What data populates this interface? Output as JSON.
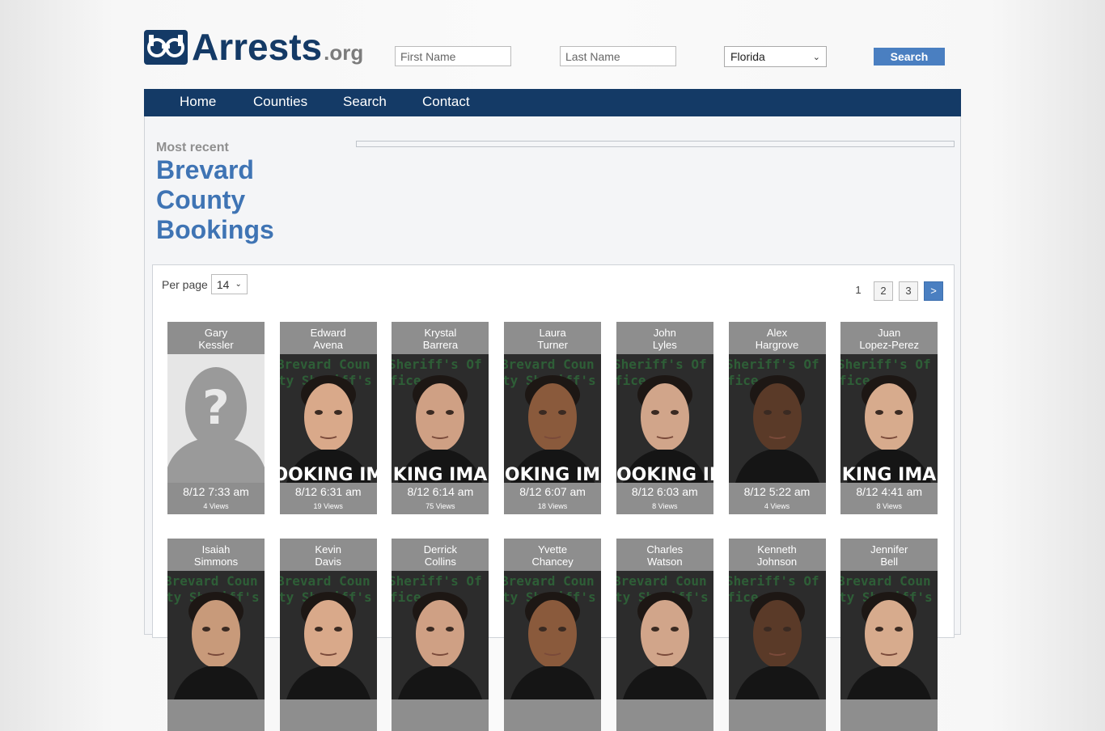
{
  "site": {
    "name": "Arrests",
    "tld": ".org"
  },
  "header": {
    "first_name_placeholder": "First Name",
    "last_name_placeholder": "Last Name",
    "state_selected": "Florida",
    "search_label": "Search"
  },
  "nav": {
    "items": [
      "Home",
      "Counties",
      "Search",
      "Contact"
    ]
  },
  "page": {
    "subheading": "Most recent",
    "title": "Brevard County Bookings"
  },
  "listing": {
    "per_page_label": "Per page",
    "per_page_value": "14",
    "pages": [
      "1",
      "2",
      "3"
    ],
    "next_label": ">",
    "cards": [
      {
        "first": "Gary",
        "last": "Kessler",
        "time": "8/12 7:33 am",
        "views": "4 Views",
        "photo": "placeholder-silhouette"
      },
      {
        "first": "Edward",
        "last": "Avena",
        "time": "8/12 6:31 am",
        "views": "19 Views",
        "photo": "mugshot",
        "overlay": "BOOKING IMA",
        "watermark": "Brevard County Sheriff's Office"
      },
      {
        "first": "Krystal",
        "last": "Barrera",
        "time": "8/12 6:14 am",
        "views": "75 Views",
        "photo": "mugshot",
        "overlay": "KING IMA",
        "watermark": "Sheriff's Office"
      },
      {
        "first": "Laura",
        "last": "Turner",
        "time": "8/12 6:07 am",
        "views": "18 Views",
        "photo": "mugshot",
        "overlay": "OKING IM",
        "watermark": "Brevard County Sheriff's Office"
      },
      {
        "first": "John",
        "last": "Lyles",
        "time": "8/12 6:03 am",
        "views": "8 Views",
        "photo": "mugshot",
        "overlay": "BOOKING IM",
        "watermark": "Sheriff's Office"
      },
      {
        "first": "Alex",
        "last": "Hargrove",
        "time": "8/12 5:22 am",
        "views": "4 Views",
        "photo": "mugshot",
        "overlay": "",
        "watermark": "Sheriff's Office"
      },
      {
        "first": "Juan",
        "last": "Lopez-Perez",
        "time": "8/12 4:41 am",
        "views": "8 Views",
        "photo": "mugshot",
        "overlay": "KING IMA",
        "watermark": "Sheriff's Office"
      },
      {
        "first": "Isaiah",
        "last": "Simmons",
        "photo": "mugshot",
        "watermark": "Brevard County Sheriff's Office"
      },
      {
        "first": "Kevin",
        "last": "Davis",
        "photo": "mugshot",
        "watermark": "Brevard County Sheriff's Office"
      },
      {
        "first": "Derrick",
        "last": "Collins",
        "photo": "mugshot",
        "watermark": "Sheriff's Office"
      },
      {
        "first": "Yvette",
        "last": "Chancey",
        "photo": "mugshot",
        "watermark": "Brevard County Sheriff's"
      },
      {
        "first": "Charles",
        "last": "Watson",
        "photo": "mugshot",
        "watermark": "Brevard County Sheriff's Office"
      },
      {
        "first": "Kenneth",
        "last": "Johnson",
        "photo": "mugshot",
        "watermark": "Sheriff's Office"
      },
      {
        "first": "Jennifer",
        "last": "Bell",
        "photo": "mugshot",
        "watermark": "Brevard County Sheriff's Office"
      }
    ]
  },
  "colors": {
    "brand_navy": "#143a66",
    "accent_blue": "#4a7fc1",
    "title_blue": "#3f74b4",
    "card_gray": "#8e8e8e"
  }
}
